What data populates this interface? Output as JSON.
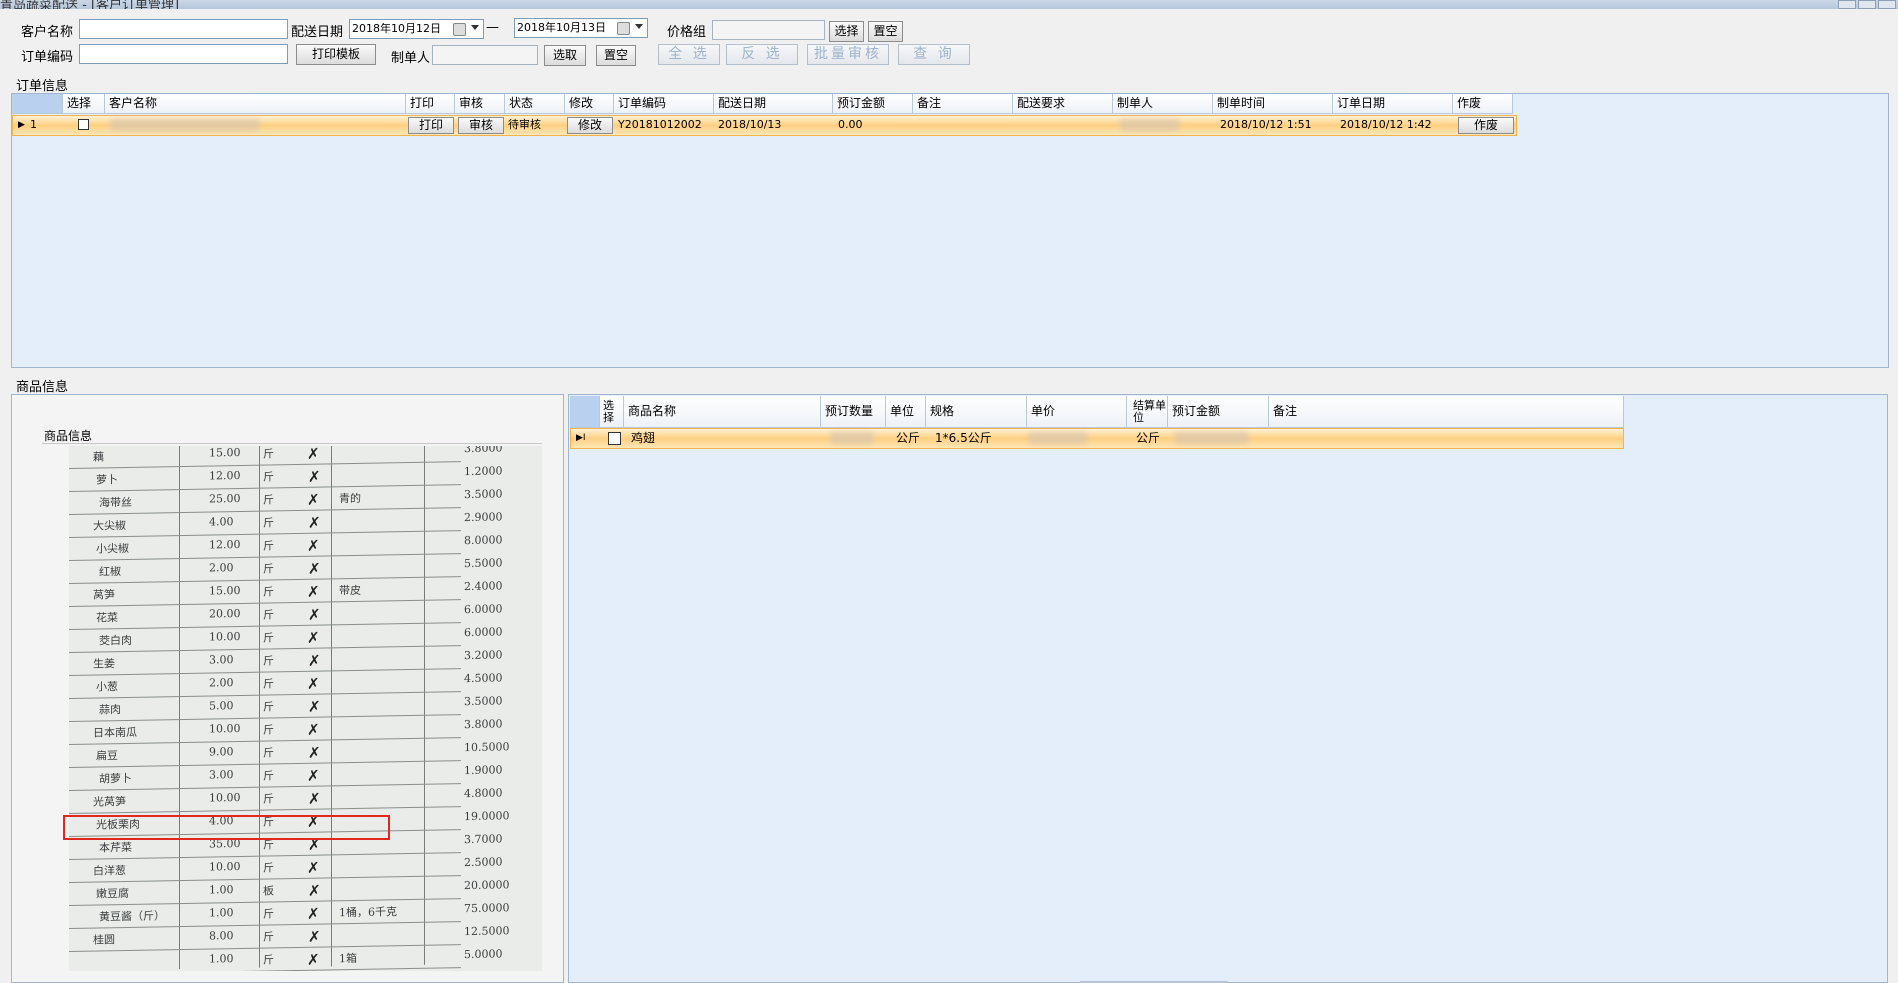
{
  "window": {
    "title": "青岛蔬菜配送 - [客户订单管理]"
  },
  "filters": {
    "customer_name_label": "客户名称",
    "delivery_date_label": "配送日期",
    "date_from": "2018年10月12日",
    "date_sep": "—",
    "date_to": "2018年10月13日",
    "price_group_label": "价格组",
    "select_label": "选择",
    "clear_label": "置空",
    "order_code_label": "订单编码",
    "print_template_label": "打印模板",
    "creator_label": "制单人",
    "pick_label": "选取",
    "clear2_label": "置空",
    "select_all_label": "全 选",
    "invert_label": "反 选",
    "batch_audit_label": "批量审核",
    "query_label": "查 询"
  },
  "orders": {
    "section_title": "订单信息",
    "columns": [
      "选择",
      "客户名称",
      "打印",
      "审核",
      "状态",
      "修改",
      "订单编码",
      "配送日期",
      "预订金额",
      "备注",
      "配送要求",
      "制单人",
      "制单时间",
      "订单日期",
      "作废"
    ],
    "rows": [
      {
        "row_no": "1",
        "print_btn": "打印",
        "audit_btn": "审核",
        "status": "待审核",
        "edit_btn": "修改",
        "order_code": "Y20181012002",
        "delivery_date": "2018/10/13",
        "amount": "0.00",
        "created_time": "2018/10/12 1:51",
        "order_date": "2018/10/12 1:42",
        "void_btn": "作废"
      }
    ]
  },
  "goods": {
    "section_title": "商品信息",
    "image_panel_title": "商品信息",
    "columns": [
      "选择",
      "商品名称",
      "预订数量",
      "单位",
      "规格",
      "单价",
      "结算单位",
      "预订金额",
      "备注"
    ],
    "rows": [
      {
        "name": "鸡翅",
        "unit": "公斤",
        "spec": "1*6.5公斤",
        "settle_unit": "公斤"
      }
    ]
  },
  "photo": {
    "rows": [
      {
        "name": "藕",
        "qty": "15.00",
        "unit": "斤",
        "note": "",
        "price": "3.8000"
      },
      {
        "name": "萝卜",
        "qty": "12.00",
        "unit": "斤",
        "note": "",
        "price": "1.2000"
      },
      {
        "name": "海带丝",
        "qty": "25.00",
        "unit": "斤",
        "note": "青的",
        "price": "3.5000"
      },
      {
        "name": "大尖椒",
        "qty": "4.00",
        "unit": "斤",
        "note": "",
        "price": "2.9000"
      },
      {
        "name": "小尖椒",
        "qty": "12.00",
        "unit": "斤",
        "note": "",
        "price": "8.0000"
      },
      {
        "name": "红椒",
        "qty": "2.00",
        "unit": "斤",
        "note": "",
        "price": "5.5000"
      },
      {
        "name": "莴笋",
        "qty": "15.00",
        "unit": "斤",
        "note": "带皮",
        "price": "2.4000"
      },
      {
        "name": "花菜",
        "qty": "20.00",
        "unit": "斤",
        "note": "",
        "price": "6.0000"
      },
      {
        "name": "茭白肉",
        "qty": "10.00",
        "unit": "斤",
        "note": "",
        "price": "6.0000"
      },
      {
        "name": "生姜",
        "qty": "3.00",
        "unit": "斤",
        "note": "",
        "price": "3.2000"
      },
      {
        "name": "小葱",
        "qty": "2.00",
        "unit": "斤",
        "note": "",
        "price": "4.5000"
      },
      {
        "name": "蒜肉",
        "qty": "5.00",
        "unit": "斤",
        "note": "",
        "price": "3.5000"
      },
      {
        "name": "日本南瓜",
        "qty": "10.00",
        "unit": "斤",
        "note": "",
        "price": "3.8000"
      },
      {
        "name": "扁豆",
        "qty": "9.00",
        "unit": "斤",
        "note": "",
        "price": "10.5000"
      },
      {
        "name": "胡萝卜",
        "qty": "3.00",
        "unit": "斤",
        "note": "",
        "price": "1.9000"
      },
      {
        "name": "光莴笋",
        "qty": "10.00",
        "unit": "斤",
        "note": "",
        "price": "4.8000"
      },
      {
        "name": "光板栗肉",
        "qty": "4.00",
        "unit": "斤",
        "note": "",
        "price": "19.0000"
      },
      {
        "name": "本芹菜",
        "qty": "35.00",
        "unit": "斤",
        "note": "",
        "price": "3.7000"
      },
      {
        "name": "白洋葱",
        "qty": "10.00",
        "unit": "斤",
        "note": "",
        "price": "2.5000"
      },
      {
        "name": "嫩豆腐",
        "qty": "1.00",
        "unit": "板",
        "note": "",
        "price": "20.0000"
      },
      {
        "name": "黄豆酱（斤）",
        "qty": "1.00",
        "unit": "斤",
        "note": "1桶，6千克",
        "price": "75.0000"
      },
      {
        "name": "桂圆",
        "qty": "8.00",
        "unit": "斤",
        "note": "",
        "price": "12.5000"
      },
      {
        "name": "",
        "qty": "1.00",
        "unit": "斤",
        "note": "1箱",
        "price": "5.0000"
      }
    ]
  }
}
